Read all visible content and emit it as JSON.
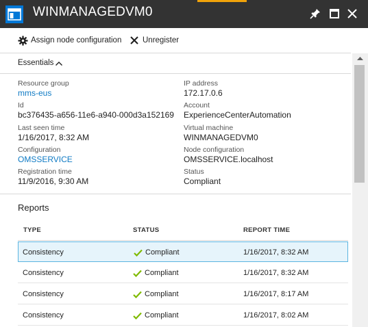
{
  "window": {
    "title": "WINMANAGEDVM0",
    "buttons": {
      "pin": "pin-icon",
      "maximize": "maximize-icon",
      "close": "close-icon"
    }
  },
  "commands": {
    "assign_label": "Assign node configuration",
    "unregister_label": "Unregister"
  },
  "essentials": {
    "label": "Essentials",
    "left": [
      {
        "label": "Resource group",
        "value": "mms-eus",
        "link": true
      },
      {
        "label": "Id",
        "value": "bc376435-a656-11e6-a940-000d3a152169",
        "link": false
      },
      {
        "label": "Last seen time",
        "value": "1/16/2017, 8:32 AM",
        "link": false
      },
      {
        "label": "Configuration",
        "value": "OMSSERVICE",
        "link": true
      },
      {
        "label": "Registration time",
        "value": "11/9/2016, 9:30 AM",
        "link": false
      }
    ],
    "right": [
      {
        "label": "IP address",
        "value": "172.17.0.6"
      },
      {
        "label": "Account",
        "value": "ExperienceCenterAutomation"
      },
      {
        "label": "Virtual machine",
        "value": "WINMANAGEDVM0"
      },
      {
        "label": "Node configuration",
        "value": "OMSSERVICE.localhost"
      },
      {
        "label": "Status",
        "value": "Compliant"
      }
    ]
  },
  "reports": {
    "title": "Reports",
    "columns": [
      "TYPE",
      "STATUS",
      "REPORT TIME"
    ],
    "rows": [
      {
        "type": "Consistency",
        "status": "Compliant",
        "time": "1/16/2017, 8:32 AM",
        "selected": true
      },
      {
        "type": "Consistency",
        "status": "Compliant",
        "time": "1/16/2017, 8:32 AM",
        "selected": false
      },
      {
        "type": "Consistency",
        "status": "Compliant",
        "time": "1/16/2017, 8:17 AM",
        "selected": false
      },
      {
        "type": "Consistency",
        "status": "Compliant",
        "time": "1/16/2017, 8:02 AM",
        "selected": false
      }
    ]
  },
  "colors": {
    "titlebar": "#333333",
    "accent": "#f0a30a",
    "link": "#0e7ac4",
    "compliant_check": "#7fba00",
    "selected_row": "#e6f4fb"
  }
}
